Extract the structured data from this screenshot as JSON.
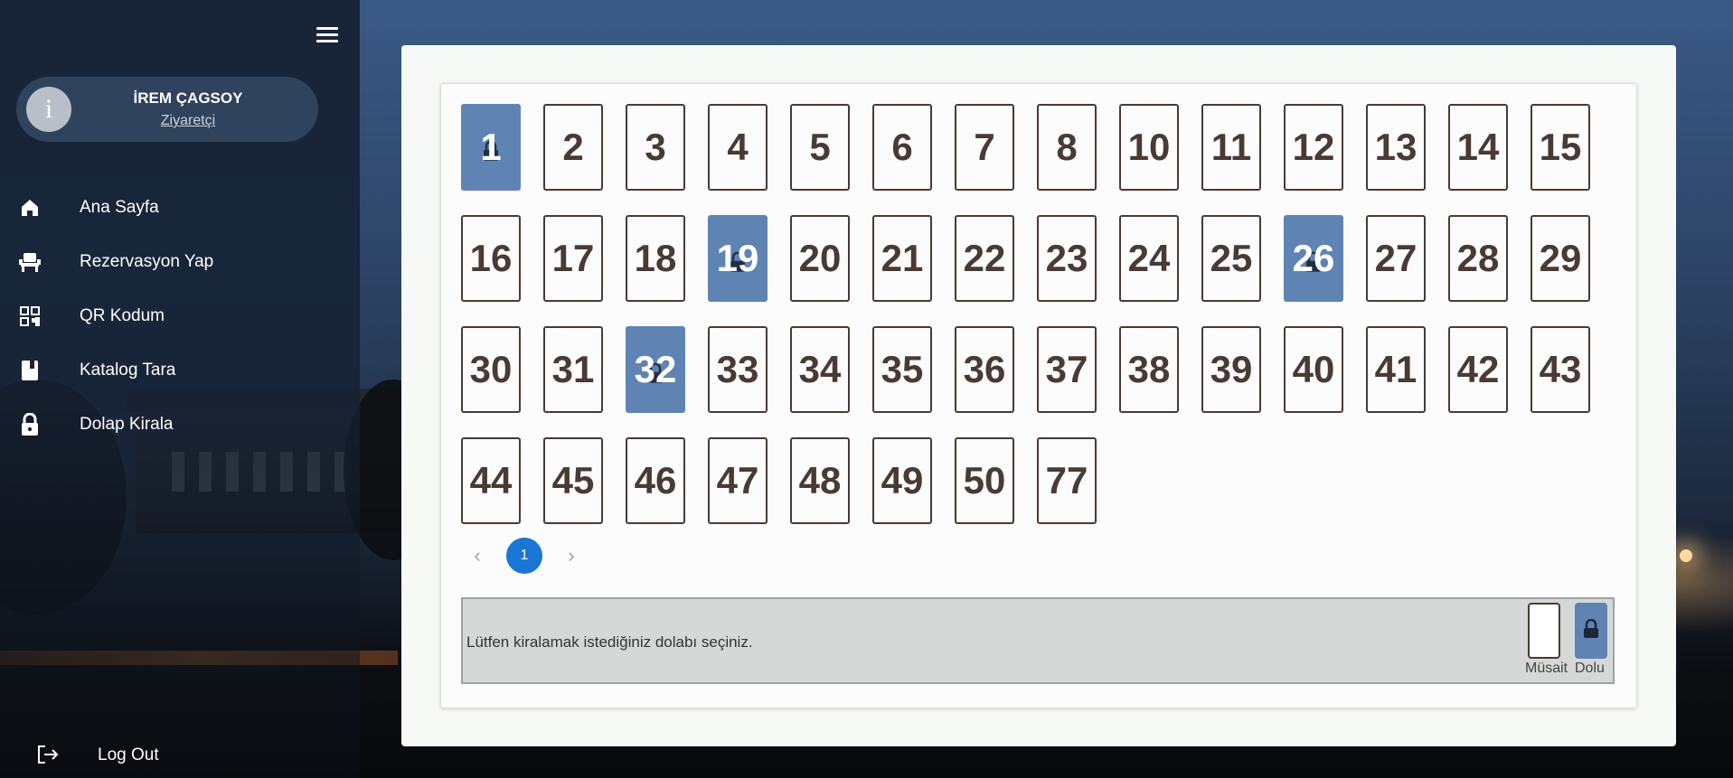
{
  "sidebar": {
    "user": {
      "avatar_letter": "i",
      "name": "İREM ÇAGSOY",
      "role": "Ziyaretçi"
    },
    "nav": [
      {
        "label": "Ana Sayfa",
        "icon": "home-icon"
      },
      {
        "label": "Rezervasyon Yap",
        "icon": "seat-icon"
      },
      {
        "label": "QR Kodum",
        "icon": "qr-code-icon"
      },
      {
        "label": "Katalog Tara",
        "icon": "book-icon"
      },
      {
        "label": "Dolap Kirala",
        "icon": "lock-icon"
      }
    ],
    "logout_label": "Log Out"
  },
  "lockers": {
    "rows": [
      [
        {
          "n": "1",
          "occupied": true
        },
        {
          "n": "2"
        },
        {
          "n": "3"
        },
        {
          "n": "4"
        },
        {
          "n": "5"
        },
        {
          "n": "6"
        },
        {
          "n": "7"
        },
        {
          "n": "8"
        },
        {
          "n": "10"
        },
        {
          "n": "11"
        },
        {
          "n": "12"
        },
        {
          "n": "13"
        },
        {
          "n": "14"
        },
        {
          "n": "15"
        }
      ],
      [
        {
          "n": "16"
        },
        {
          "n": "17"
        },
        {
          "n": "18"
        },
        {
          "n": "19",
          "occupied": true
        },
        {
          "n": "20"
        },
        {
          "n": "21"
        },
        {
          "n": "22"
        },
        {
          "n": "23"
        },
        {
          "n": "24"
        },
        {
          "n": "25"
        },
        {
          "n": "26",
          "occupied": true
        },
        {
          "n": "27"
        },
        {
          "n": "28"
        },
        {
          "n": "29"
        }
      ],
      [
        {
          "n": "30"
        },
        {
          "n": "31"
        },
        {
          "n": "32",
          "occupied": true
        },
        {
          "n": "33"
        },
        {
          "n": "34"
        },
        {
          "n": "35"
        },
        {
          "n": "36"
        },
        {
          "n": "37"
        },
        {
          "n": "38"
        },
        {
          "n": "39"
        },
        {
          "n": "40"
        },
        {
          "n": "41"
        },
        {
          "n": "42"
        },
        {
          "n": "43"
        }
      ],
      [
        {
          "n": "44"
        },
        {
          "n": "45"
        },
        {
          "n": "46"
        },
        {
          "n": "47"
        },
        {
          "n": "48"
        },
        {
          "n": "49"
        },
        {
          "n": "50"
        },
        {
          "n": "77"
        }
      ]
    ]
  },
  "pagination": {
    "current": "1",
    "prev_icon": "chevron-left-icon",
    "next_icon": "chevron-right-icon"
  },
  "info": {
    "message": "Lütfen kiralamak istediğiniz dolabı seçiniz.",
    "legend_available": "Müsait",
    "legend_full": "Dolu"
  },
  "colors": {
    "occupied": "#5f84b3",
    "accent": "#1976d2",
    "sidebar": "#16223a"
  }
}
